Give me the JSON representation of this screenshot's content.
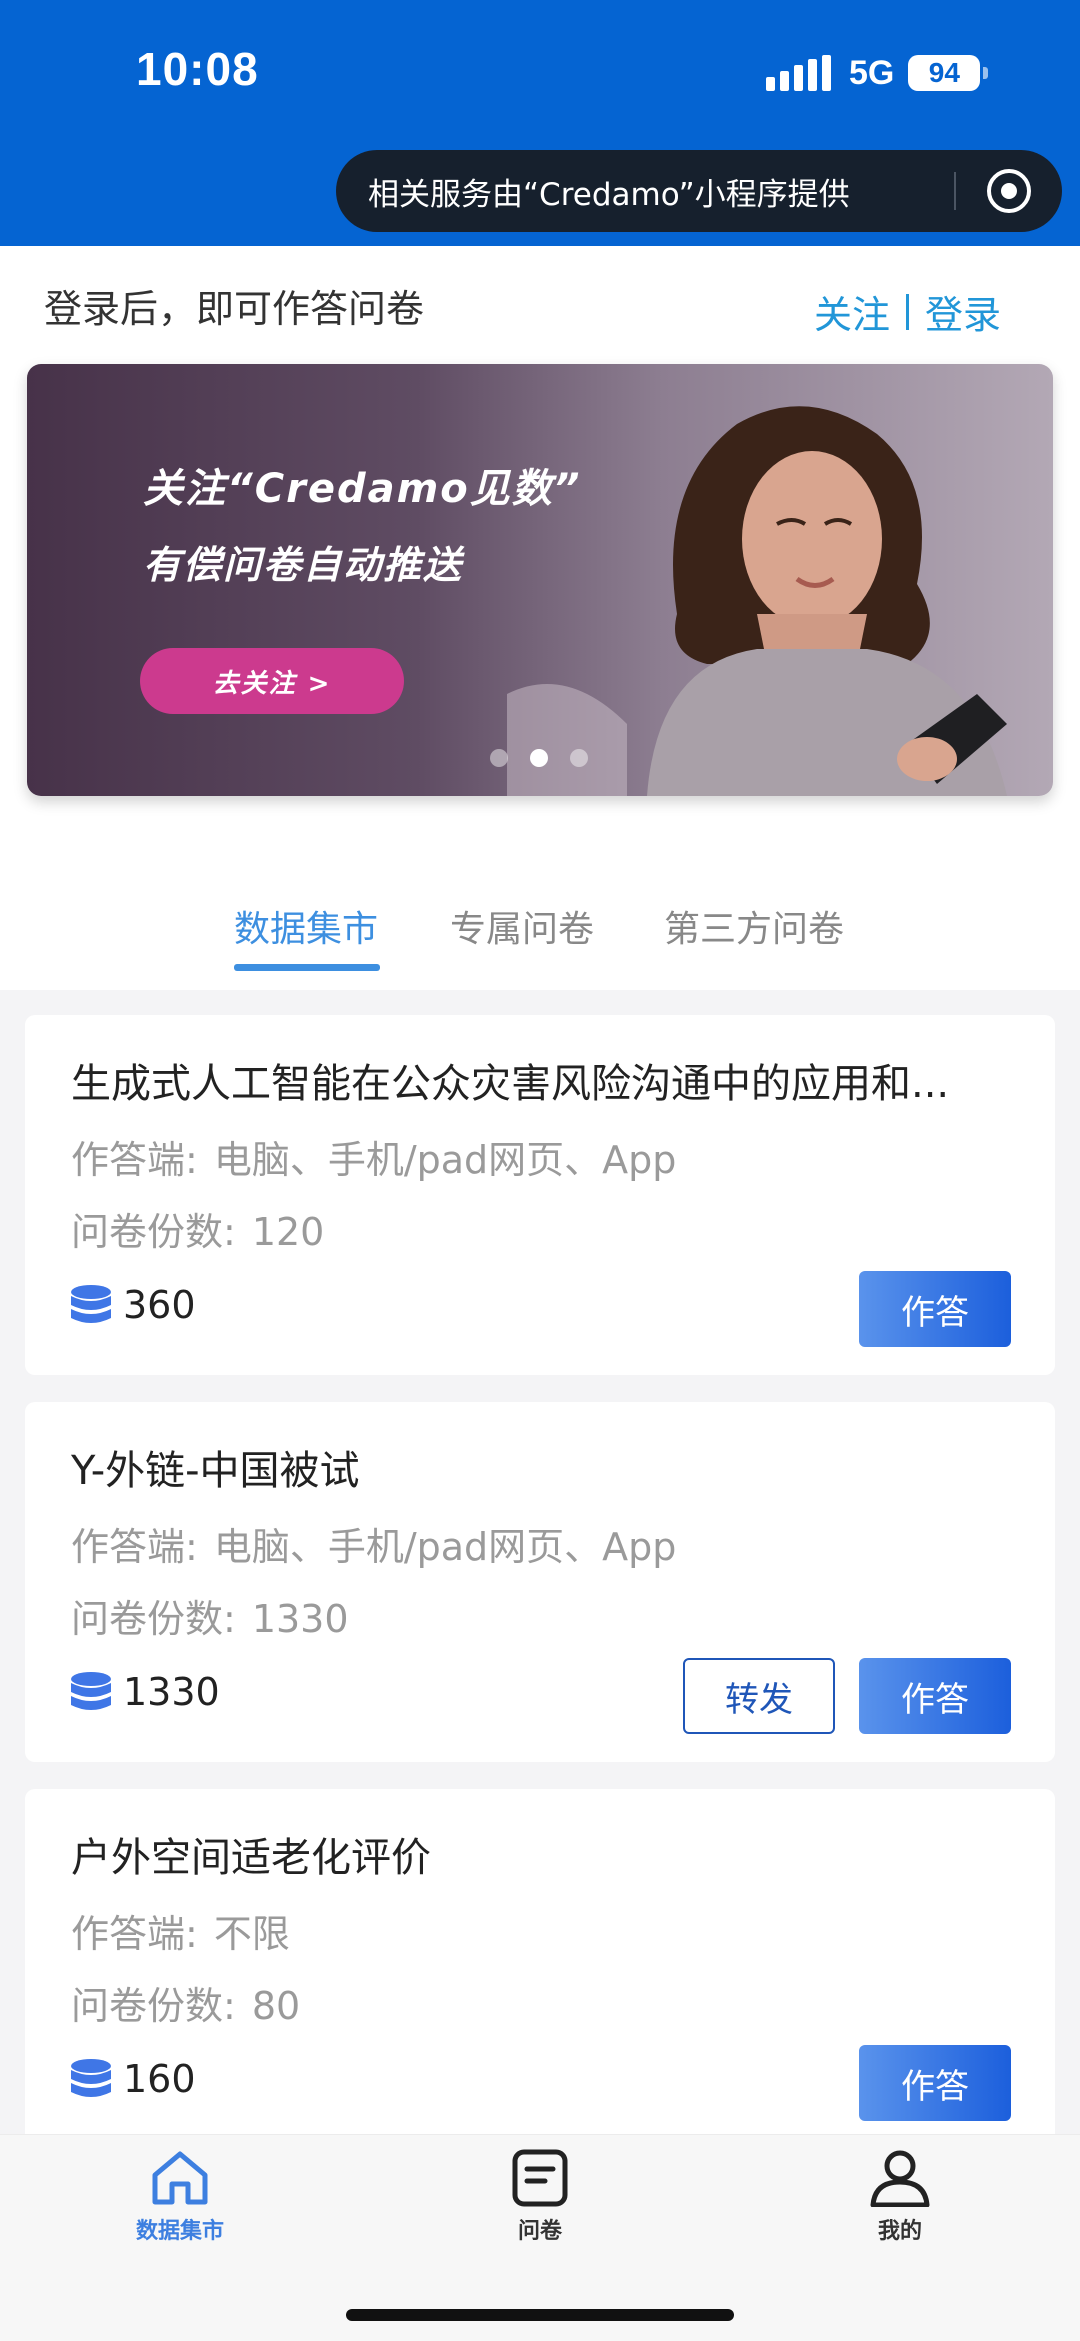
{
  "status_bar": {
    "time": "10:08",
    "network": "5G",
    "battery": "94"
  },
  "capsule": {
    "text": "相关服务由“Credamo”小程序提供"
  },
  "header": {
    "login_tip": "登录后，即可作答问卷",
    "follow": "关注",
    "login": "登录"
  },
  "banner": {
    "line1": "关注“Credamo见数”",
    "line2": "有偿问卷自动推送",
    "button": "去关注 >",
    "active_slide": 2,
    "slide_count": 3
  },
  "tabs": [
    {
      "label": "数据集市",
      "active": true
    },
    {
      "label": "专属问卷",
      "active": false
    },
    {
      "label": "第三方问卷",
      "active": false
    }
  ],
  "labels": {
    "client": "作答端:",
    "copies": "问卷份数:",
    "answer": "作答",
    "forward": "转发"
  },
  "surveys": [
    {
      "title": "生成式人工智能在公众灾害风险沟通中的应用和...",
      "client": "电脑、手机/pad网页、App",
      "copies": "120",
      "points": "360",
      "has_forward": false
    },
    {
      "title": "Y-外链-中国被试",
      "client": "电脑、手机/pad网页、App",
      "copies": "1330",
      "points": "1330",
      "has_forward": true
    },
    {
      "title": "户外空间适老化评价",
      "client": "不限",
      "copies": "80",
      "points": "160",
      "has_forward": false
    }
  ],
  "bottom_nav": [
    {
      "label": "数据集市",
      "icon": "home-icon",
      "active": true
    },
    {
      "label": "问卷",
      "icon": "document-icon",
      "active": false
    },
    {
      "label": "我的",
      "icon": "user-icon",
      "active": false
    }
  ],
  "colors": {
    "header_blue": "#0564d2",
    "accent": "#3d8fe0",
    "answer_button": "#1c5fdc",
    "banner_button": "#cc3a8e"
  }
}
